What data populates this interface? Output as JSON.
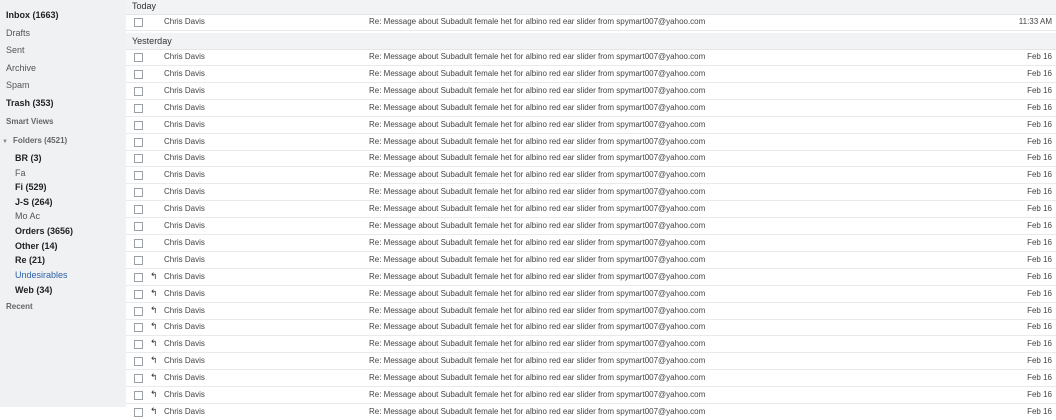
{
  "sidebar": {
    "items": [
      {
        "label": "Inbox (1663)"
      },
      {
        "label": "Drafts"
      },
      {
        "label": "Sent"
      },
      {
        "label": "Archive"
      },
      {
        "label": "Spam"
      },
      {
        "label": "Trash (353)"
      },
      {
        "label": "Smart Views"
      },
      {
        "label": "Folders (4521)"
      },
      {
        "label": "BR (3)"
      },
      {
        "label": "Fa"
      },
      {
        "label": "Fi (529)"
      },
      {
        "label": "J-S (264)"
      },
      {
        "label": "Mo Ac"
      },
      {
        "label": "Orders (3656)"
      },
      {
        "label": "Other (14)"
      },
      {
        "label": "Re (21)"
      },
      {
        "label": "Undesirables"
      },
      {
        "label": "Web (34)"
      },
      {
        "label": "Recent"
      }
    ]
  },
  "groups": {
    "today": "Today",
    "yesterday": "Yesterday"
  },
  "messages": [
    {
      "sender": "Chris Davis",
      "subject": "Re: Message about Subadult female het for albino red ear slider from spymart007@yahoo.com",
      "date": "11:33 AM",
      "replied": false
    },
    {
      "sender": "Chris Davis",
      "subject": "Re: Message about Subadult female het for albino red ear slider from spymart007@yahoo.com",
      "date": "Feb 16",
      "replied": false
    },
    {
      "sender": "Chris Davis",
      "subject": "Re: Message about Subadult female het for albino red ear slider from spymart007@yahoo.com",
      "date": "Feb 16",
      "replied": false
    },
    {
      "sender": "Chris Davis",
      "subject": "Re: Message about Subadult female het for albino red ear slider from spymart007@yahoo.com",
      "date": "Feb 16",
      "replied": false
    },
    {
      "sender": "Chris Davis",
      "subject": "Re: Message about Subadult female het for albino red ear slider from spymart007@yahoo.com",
      "date": "Feb 16",
      "replied": false
    },
    {
      "sender": "Chris Davis",
      "subject": "Re: Message about Subadult female het for albino red ear slider from spymart007@yahoo.com",
      "date": "Feb 16",
      "replied": false
    },
    {
      "sender": "Chris Davis",
      "subject": "Re: Message about Subadult female het for albino red ear slider from spymart007@yahoo.com",
      "date": "Feb 16",
      "replied": false
    },
    {
      "sender": "Chris Davis",
      "subject": "Re: Message about Subadult female het for albino red ear slider from spymart007@yahoo.com",
      "date": "Feb 16",
      "replied": false
    },
    {
      "sender": "Chris Davis",
      "subject": "Re: Message about Subadult female het for albino red ear slider from spymart007@yahoo.com",
      "date": "Feb 16",
      "replied": false
    },
    {
      "sender": "Chris Davis",
      "subject": "Re: Message about Subadult female het for albino red ear slider from spymart007@yahoo.com",
      "date": "Feb 16",
      "replied": false
    },
    {
      "sender": "Chris Davis",
      "subject": "Re: Message about Subadult female het for albino red ear slider from spymart007@yahoo.com",
      "date": "Feb 16",
      "replied": false
    },
    {
      "sender": "Chris Davis",
      "subject": "Re: Message about Subadult female het for albino red ear slider from spymart007@yahoo.com",
      "date": "Feb 16",
      "replied": false
    },
    {
      "sender": "Chris Davis",
      "subject": "Re: Message about Subadult female het for albino red ear slider from spymart007@yahoo.com",
      "date": "Feb 16",
      "replied": false
    },
    {
      "sender": "Chris Davis",
      "subject": "Re: Message about Subadult female het for albino red ear slider from spymart007@yahoo.com",
      "date": "Feb 16",
      "replied": false
    },
    {
      "sender": "Chris Davis",
      "subject": "Re: Message about Subadult female het for albino red ear slider from spymart007@yahoo.com",
      "date": "Feb 16",
      "replied": true
    },
    {
      "sender": "Chris Davis",
      "subject": "Re: Message about Subadult female het for albino red ear slider from spymart007@yahoo.com",
      "date": "Feb 16",
      "replied": true
    },
    {
      "sender": "Chris Davis",
      "subject": "Re: Message about Subadult female het for albino red ear slider from spymart007@yahoo.com",
      "date": "Feb 16",
      "replied": true
    },
    {
      "sender": "Chris Davis",
      "subject": "Re: Message about Subadult female het for albino red ear slider from spymart007@yahoo.com",
      "date": "Feb 16",
      "replied": true
    },
    {
      "sender": "Chris Davis",
      "subject": "Re: Message about Subadult female het for albino red ear slider from spymart007@yahoo.com",
      "date": "Feb 16",
      "replied": true
    },
    {
      "sender": "Chris Davis",
      "subject": "Re: Message about Subadult female het for albino red ear slider from spymart007@yahoo.com",
      "date": "Feb 16",
      "replied": true
    },
    {
      "sender": "Chris Davis",
      "subject": "Re: Message about Subadult female het for albino red ear slider from spymart007@yahoo.com",
      "date": "Feb 16",
      "replied": true
    },
    {
      "sender": "Chris Davis",
      "subject": "Re: Message about Subadult female het for albino red ear slider from spymart007@yahoo.com",
      "date": "Feb 16",
      "replied": true
    },
    {
      "sender": "Chris Davis",
      "subject": "Re: Message about Subadult female het for albino red ear slider from spymart007@yahoo.com",
      "date": "Feb 16",
      "replied": true
    }
  ],
  "icons": {
    "reply": "reply-arrow-icon",
    "checkbox": "checkbox"
  },
  "colors": {
    "link": "#2b5fa8",
    "sidebar_bg": "#f0f1f3"
  }
}
